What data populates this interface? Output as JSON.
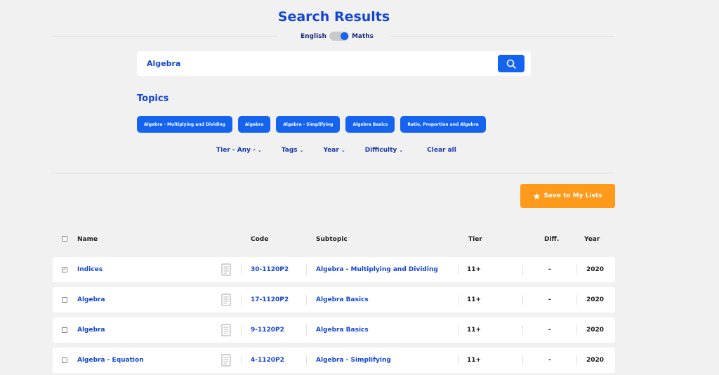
{
  "header": {
    "title": "Search Results"
  },
  "toggle": {
    "left_label": "English",
    "right_label": "Maths"
  },
  "search": {
    "value": "Algebra"
  },
  "topics": {
    "heading": "Topics",
    "chips": [
      "Algebra - Multiplying and Dividing",
      "Algebra",
      "Algebra - Simplifying",
      "Algebra Basics",
      "Ratio, Proportion and Algebra"
    ]
  },
  "filters": {
    "tier": "Tier  - Any -",
    "tags": "Tags",
    "year": "Year",
    "difficulty": "Difficulty",
    "clear": "Clear all"
  },
  "actions": {
    "save_label": "Save to My Lists"
  },
  "colors": {
    "accent": "#1464f0",
    "title": "#1446d6",
    "save": "#ff9a1a",
    "background": "#f1f1f1"
  },
  "table": {
    "headers": {
      "name": "Name",
      "code": "Code",
      "subtopic": "Subtopic",
      "tier": "Tier",
      "diff": "Diff.",
      "year": "Year"
    },
    "rows": [
      {
        "checked": true,
        "name": "Indices",
        "code": "30-1120P2",
        "subtopic": "Algebra - Multiplying and Dividing",
        "tier": "11+",
        "diff": "-",
        "year": "2020"
      },
      {
        "checked": false,
        "name": "Algebra",
        "code": "17-1120P2",
        "subtopic": "Algebra Basics",
        "tier": "11+",
        "diff": "-",
        "year": "2020"
      },
      {
        "checked": false,
        "name": "Algebra",
        "code": "9-1120P2",
        "subtopic": "Algebra Basics",
        "tier": "11+",
        "diff": "-",
        "year": "2020"
      },
      {
        "checked": false,
        "name": "Algebra - Equation",
        "code": "4-1120P2",
        "subtopic": "Algebra - Simplifying",
        "tier": "11+",
        "diff": "-",
        "year": "2020"
      }
    ]
  }
}
